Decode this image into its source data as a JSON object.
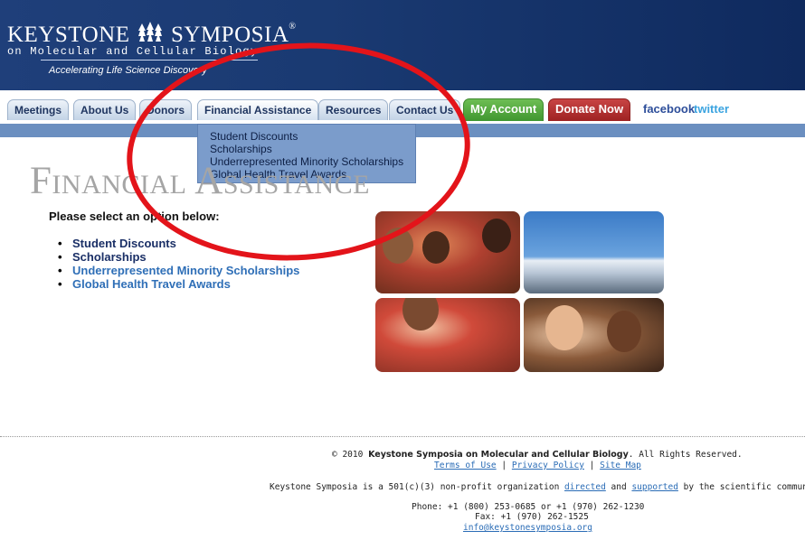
{
  "header": {
    "logo_left": "KEYSTONE",
    "logo_right": "SYMPOSIA",
    "logo_tm": "®",
    "logo_subtitle": "on Molecular and Cellular Biology",
    "tagline": "Accelerating Life Science Discovery"
  },
  "nav": {
    "tabs": [
      {
        "label": "Meetings"
      },
      {
        "label": "About Us"
      },
      {
        "label": "Donors"
      },
      {
        "label": "Financial Assistance"
      },
      {
        "label": "Resources"
      },
      {
        "label": "Contact Us"
      }
    ],
    "my_account": "My Account",
    "donate": "Donate Now",
    "facebook": "facebook",
    "twitter": "twitter",
    "dropdown": [
      {
        "label": "Student Discounts"
      },
      {
        "label": "Scholarships"
      },
      {
        "label": "Underrepresented Minority Scholarships"
      },
      {
        "label": "Global Health Travel Awards"
      }
    ]
  },
  "main": {
    "title": "Financial Assistance",
    "intro": "Please select an option below:",
    "options": [
      {
        "label": "Student Discounts"
      },
      {
        "label": "Scholarships"
      },
      {
        "label": "Underrepresented Minority Scholarships"
      },
      {
        "label": "Global Health Travel Awards"
      }
    ]
  },
  "footer": {
    "copyright_prefix": "© 2010",
    "org_name": "Keystone Symposia on Molecular and Cellular Biology",
    "copyright_suffix": ". All Rights Reserved.",
    "terms": "Terms of Use",
    "privacy": "Privacy Policy",
    "sitemap": "Site Map",
    "separator": "|",
    "nonprofit_prefix": "Keystone Symposia is a 501(c)(3) non-profit organization",
    "directed": "directed",
    "and": "and",
    "supported": "supported",
    "nonprofit_suffix": "by the scientific community.",
    "phone": "Phone: +1 (800) 253-0685 or +1 (970) 262-1230",
    "fax": "Fax: +1 (970) 262-1525",
    "email": "info@keystonesymposia.org"
  }
}
